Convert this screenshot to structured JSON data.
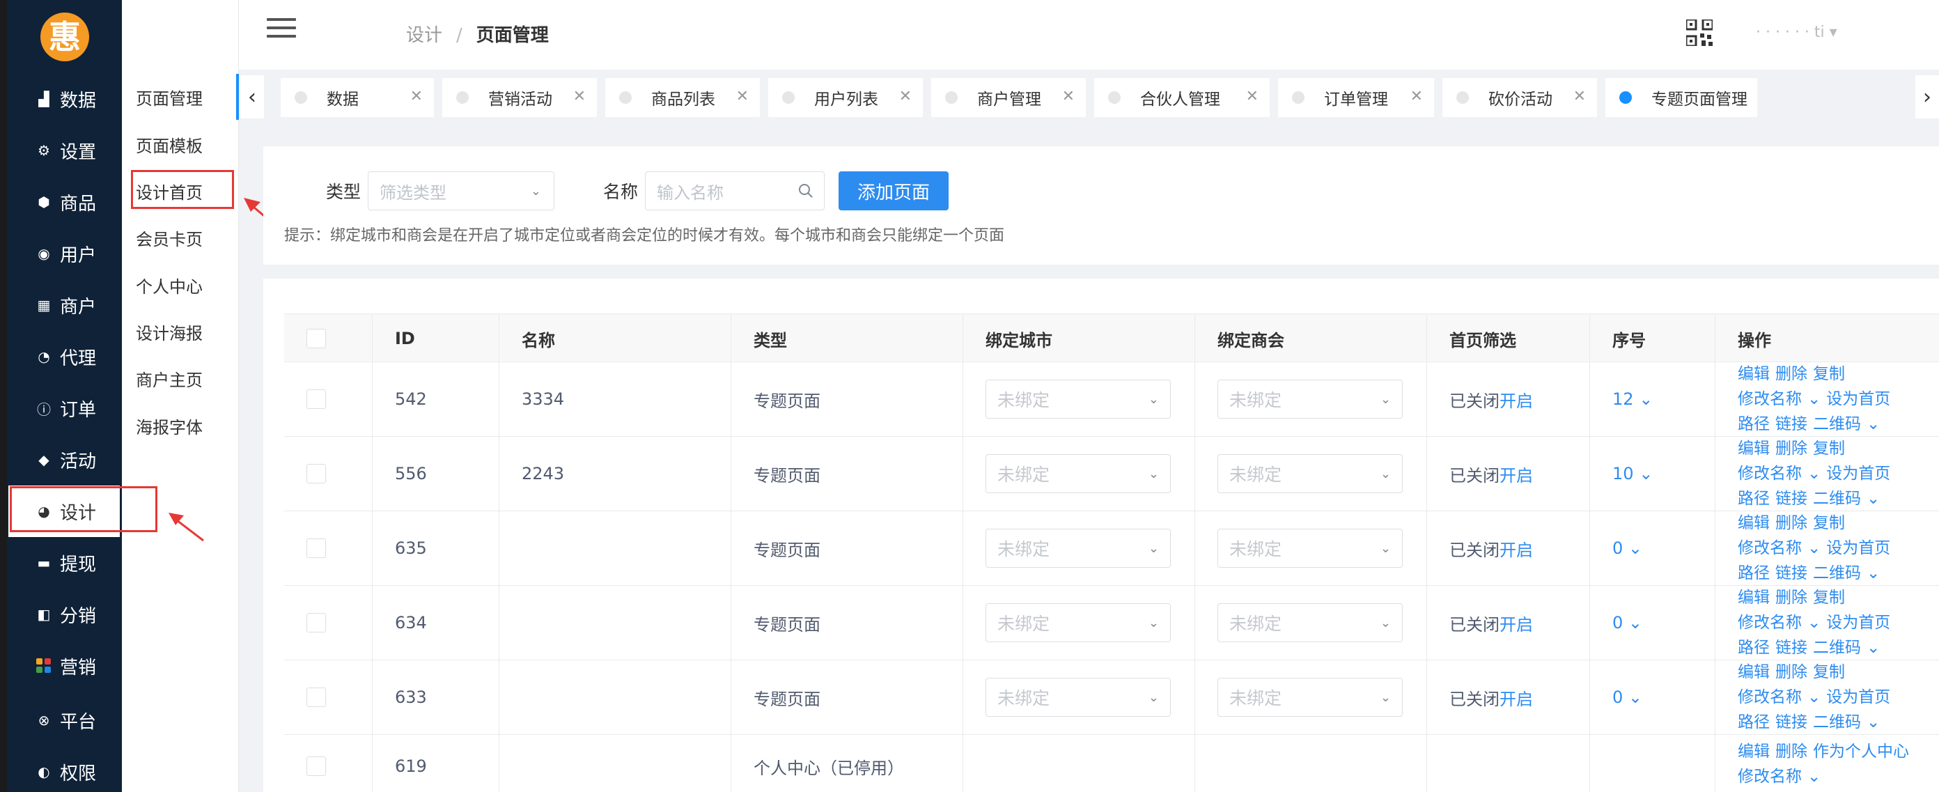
{
  "sidebar": {
    "logo_text": "惠",
    "items": [
      {
        "label": "数据",
        "icon": "bar-chart-icon"
      },
      {
        "label": "设置",
        "icon": "gear-icon"
      },
      {
        "label": "商品",
        "icon": "cube-icon"
      },
      {
        "label": "用户",
        "icon": "user-icon"
      },
      {
        "label": "商户",
        "icon": "store-icon"
      },
      {
        "label": "代理",
        "icon": "pie-icon"
      },
      {
        "label": "订单",
        "icon": "info-icon"
      },
      {
        "label": "活动",
        "icon": "tag-icon"
      },
      {
        "label": "设计",
        "icon": "palette-icon"
      },
      {
        "label": "提现",
        "icon": "card-icon"
      },
      {
        "label": "分销",
        "icon": "facebook-icon"
      },
      {
        "label": "营销",
        "icon": "grid-icon"
      },
      {
        "label": "平台",
        "icon": "xbox-icon"
      },
      {
        "label": "权限",
        "icon": "compass-icon"
      }
    ]
  },
  "submenu": {
    "items": [
      "页面管理",
      "页面模板",
      "设计首页",
      "会员卡页",
      "个人中心",
      "设计海报",
      "商户主页",
      "海报字体"
    ]
  },
  "header": {
    "breadcrumb": [
      "设计",
      "页面管理"
    ],
    "user_name": "· · · · · · ti ▾"
  },
  "tabs": [
    {
      "label": "数据"
    },
    {
      "label": "营销活动"
    },
    {
      "label": "商品列表"
    },
    {
      "label": "用户列表"
    },
    {
      "label": "商户管理"
    },
    {
      "label": "合伙人管理"
    },
    {
      "label": "订单管理"
    },
    {
      "label": "砍价活动"
    },
    {
      "label": "专题页面管理"
    }
  ],
  "filter": {
    "type_label": "类型",
    "type_placeholder": "筛选类型",
    "name_label": "名称",
    "name_placeholder": "输入名称",
    "add_button": "添加页面",
    "hint": "提示：绑定城市和商会是在开启了城市定位或者商会定位的时候才有效。每个城市和商会只能绑定一个页面"
  },
  "table": {
    "columns": [
      "ID",
      "名称",
      "类型",
      "绑定城市",
      "绑定商会",
      "首页筛选",
      "序号",
      "操作"
    ],
    "rows": [
      {
        "id": "542",
        "name": "3334",
        "type": "专题页面",
        "city": "未绑定",
        "chamber": "未绑定",
        "status": "已关闭",
        "toggle": "开启",
        "order": "12"
      },
      {
        "id": "556",
        "name": "2243",
        "type": "专题页面",
        "city": "未绑定",
        "chamber": "未绑定",
        "status": "已关闭",
        "toggle": "开启",
        "order": "10"
      },
      {
        "id": "635",
        "name": "",
        "type": "专题页面",
        "city": "未绑定",
        "chamber": "未绑定",
        "status": "已关闭",
        "toggle": "开启",
        "order": "0"
      },
      {
        "id": "634",
        "name": "",
        "type": "专题页面",
        "city": "未绑定",
        "chamber": "未绑定",
        "status": "已关闭",
        "toggle": "开启",
        "order": "0"
      },
      {
        "id": "633",
        "name": "",
        "type": "专题页面",
        "city": "未绑定",
        "chamber": "未绑定",
        "status": "已关闭",
        "toggle": "开启",
        "order": "0"
      },
      {
        "id": "619",
        "name": "",
        "type": "个人中心（已停用）"
      }
    ],
    "ops": {
      "edit": "编辑",
      "delete": "删除",
      "copy": "复制",
      "rename": "修改名称",
      "set_home": "设为首页",
      "path": "路径",
      "link": "链接",
      "qrcode": "二维码",
      "set_personal": "作为个人中心"
    }
  },
  "colors": {
    "sidebar_bg": "#0f2238",
    "accent": "#2d8cf0",
    "annotation_red": "#e53935",
    "logo": "#f59a23"
  }
}
